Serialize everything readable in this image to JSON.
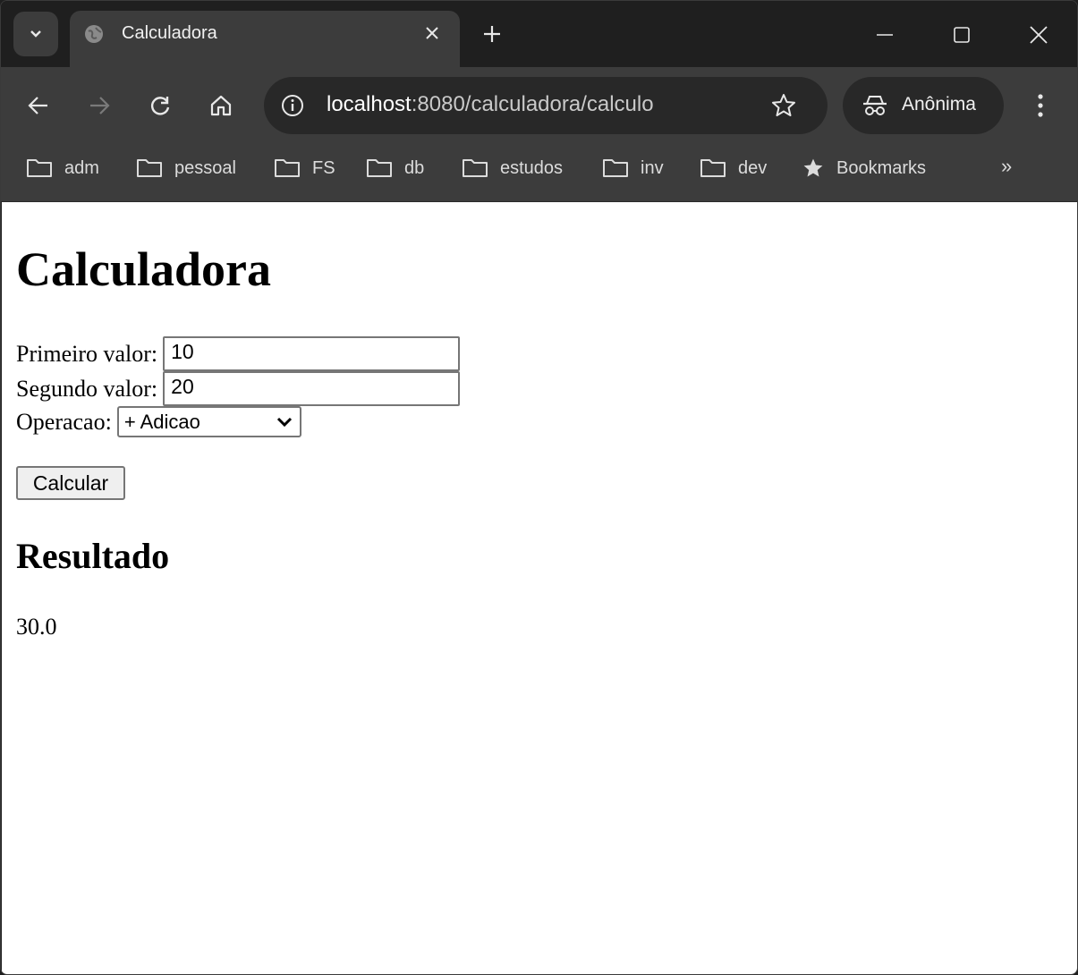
{
  "browser": {
    "tab": {
      "title": "Calculadora"
    },
    "omnibox": {
      "host": "localhost",
      "path": ":8080/calculadora/calculo"
    },
    "profile": {
      "label": "Anônima"
    },
    "bookmarks": [
      "adm",
      "pessoal",
      "FS",
      "db",
      "estudos",
      "inv",
      "dev"
    ],
    "bookmarks_star_label": "Bookmarks",
    "bookmarks_more": "»"
  },
  "page": {
    "title": "Calculadora",
    "first_label": "Primeiro valor:",
    "first_value": "10",
    "second_label": "Segundo valor:",
    "second_value": "20",
    "operation_label": "Operacao:",
    "operation_selected": "+ Adicao",
    "submit_label": "Calcular",
    "result_heading": "Resultado",
    "result_value": "30.0"
  },
  "colors": {
    "chrome_frame": "#1f1f1f",
    "chrome_toolbar": "#3c3c3c",
    "omnibox_bg": "#282828",
    "page_bg": "#ffffff"
  }
}
